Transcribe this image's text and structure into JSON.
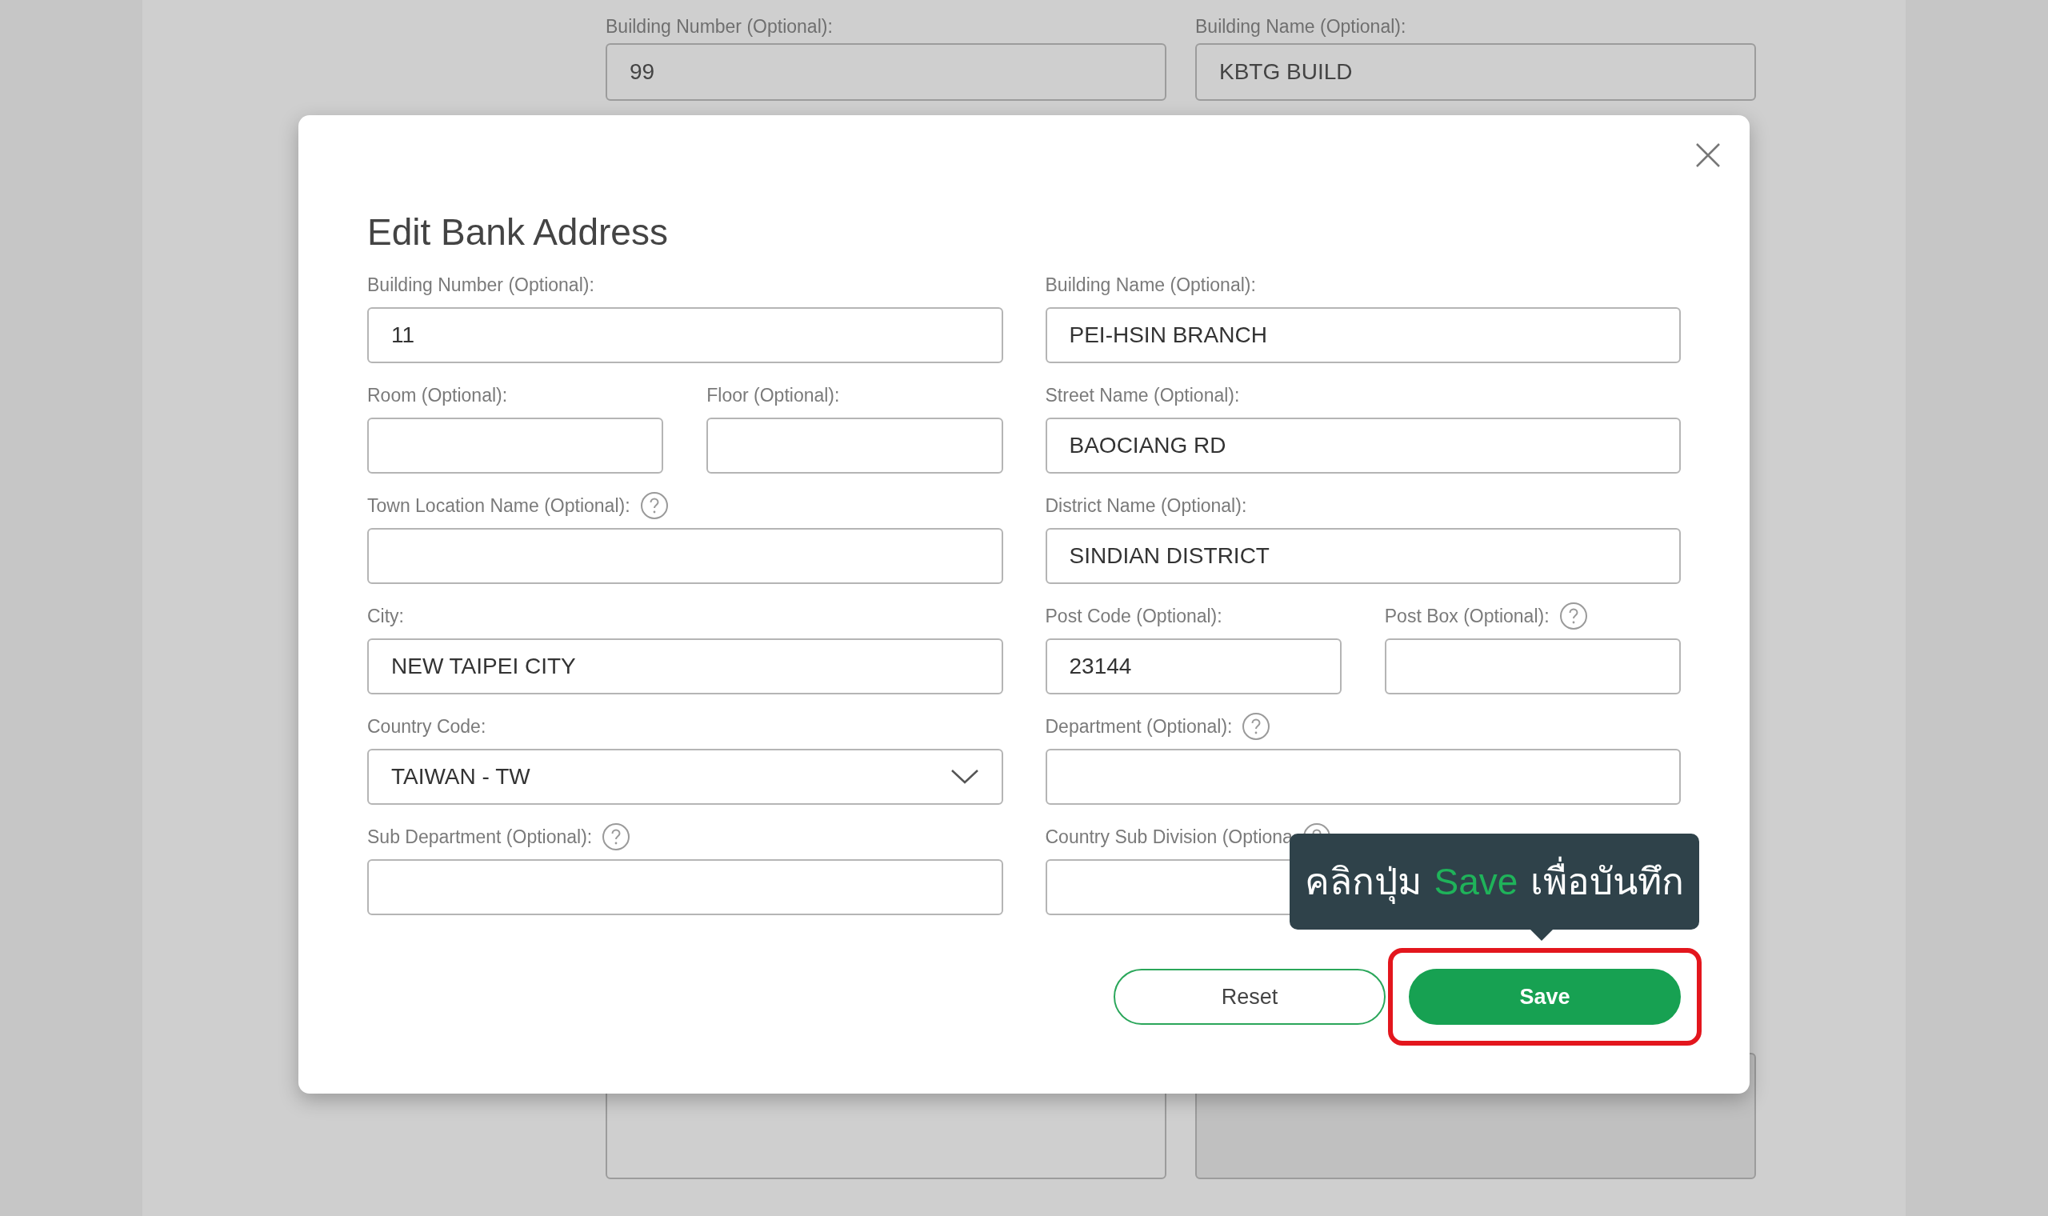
{
  "background_form": {
    "top_fields": [
      {
        "label": "Building Number (Optional):",
        "value": "99"
      },
      {
        "label": "Building Name (Optional):",
        "value": "KBTG BUILD"
      }
    ],
    "bottom_fields": [
      {
        "disabled": false
      },
      {
        "disabled": true
      }
    ]
  },
  "dialog": {
    "title": "Edit Bank Address",
    "rows": [
      {
        "left": [
          {
            "kind": "text",
            "label": "Building Number (Optional):",
            "value": "11",
            "help": false
          }
        ],
        "right": [
          {
            "kind": "text",
            "label": "Building Name (Optional):",
            "value": "PEI-HSIN BRANCH",
            "help": false
          }
        ]
      },
      {
        "left": [
          {
            "kind": "text",
            "label": "Room (Optional):",
            "help": false
          },
          {
            "kind": "text",
            "label": "Floor (Optional):",
            "help": false
          }
        ],
        "right": [
          {
            "kind": "text",
            "label": "Street Name (Optional):",
            "value": "BAOCIANG RD",
            "help": false
          }
        ]
      },
      {
        "left": [
          {
            "kind": "text",
            "label": "Town Location Name (Optional):",
            "help": true
          }
        ],
        "right": [
          {
            "kind": "text",
            "label": "District Name (Optional):",
            "value": "SINDIAN DISTRICT",
            "help": false
          }
        ]
      },
      {
        "left": [
          {
            "kind": "text",
            "label": "City:",
            "value": "NEW TAIPEI CITY",
            "help": false
          }
        ],
        "right": [
          {
            "kind": "text",
            "label": "Post Code (Optional):",
            "value": "23144",
            "help": false
          },
          {
            "kind": "text",
            "label": "Post Box (Optional):",
            "help": true
          }
        ]
      },
      {
        "left": [
          {
            "kind": "select",
            "label": "Country Code:",
            "value": "TAIWAN - TW",
            "help": false
          }
        ],
        "right": [
          {
            "kind": "text",
            "label": "Department (Optional):",
            "help": true
          }
        ]
      },
      {
        "left": [
          {
            "kind": "text",
            "label": "Sub Department (Optional):",
            "help": true
          }
        ],
        "right": [
          {
            "kind": "text",
            "label": "Country Sub Division (Optiona",
            "help": true
          }
        ]
      }
    ],
    "buttons": [
      {
        "label": "Reset",
        "kind": "secondary",
        "highlighted": false
      },
      {
        "label": "Save",
        "kind": "primary",
        "highlighted": true
      }
    ],
    "tooltip": {
      "parts": [
        {
          "text": "คลิกปุ่ม",
          "highlight": false
        },
        {
          "text": "Save",
          "highlight": true
        },
        {
          "text": "เพื่อบันทึก",
          "highlight": false
        }
      ]
    }
  }
}
